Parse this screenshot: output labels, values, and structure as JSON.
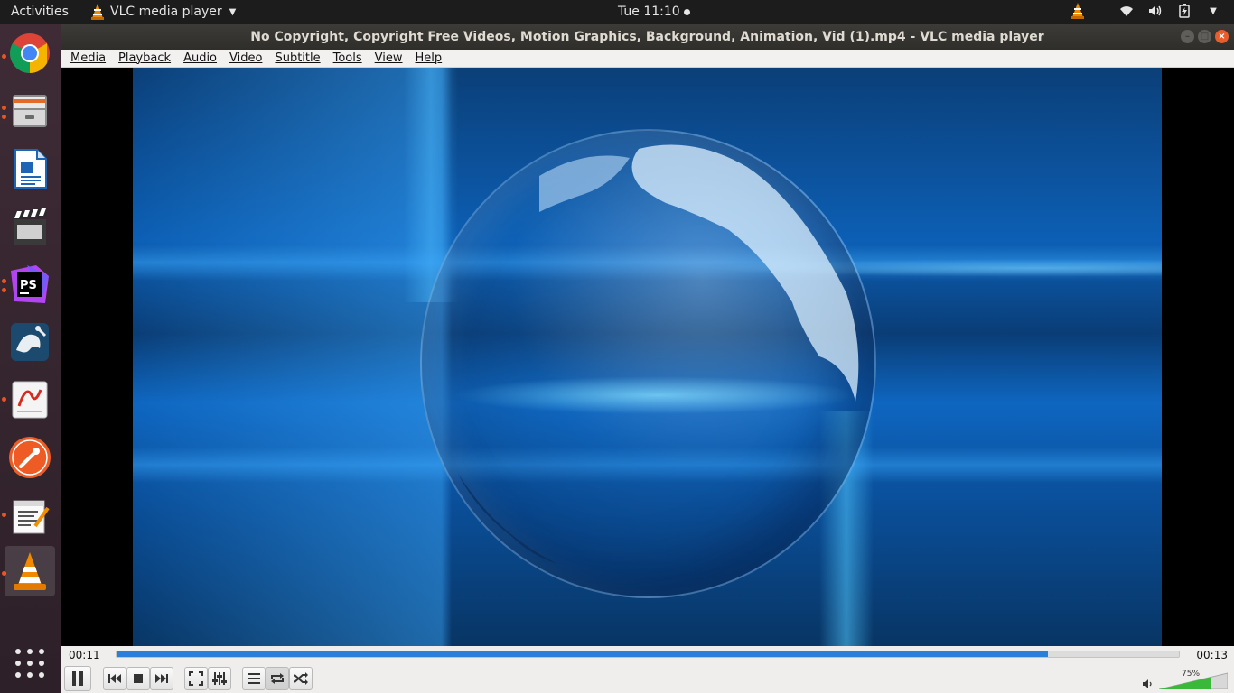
{
  "topbar": {
    "activities": "Activities",
    "app_name": "VLC media player",
    "clock": "Tue 11:10"
  },
  "window": {
    "title": "No Copyright, Copyright Free Videos, Motion Graphics, Background, Animation, Vid (1).mp4 - VLC media player"
  },
  "menu": {
    "items": [
      "Media",
      "Playback",
      "Audio",
      "Video",
      "Subtitle",
      "Tools",
      "View",
      "Help"
    ]
  },
  "dock": {
    "items": [
      "chrome-icon",
      "files-icon",
      "libreoffice-writer-icon",
      "video-editor-icon",
      "phpstorm-icon",
      "mysql-workbench-icon",
      "document-viewer-icon",
      "postman-icon",
      "text-editor-icon",
      "vlc-icon"
    ],
    "show_apps": "app-grid-icon"
  },
  "player": {
    "elapsed": "00:11",
    "total": "00:13",
    "progress_fraction": 0.877,
    "volume_label": "75%",
    "volume_fraction": 0.75
  },
  "colors": {
    "accent": "#e95420",
    "seek_fill": "#2a7fd8",
    "volume_fill": "#3ab83a"
  }
}
